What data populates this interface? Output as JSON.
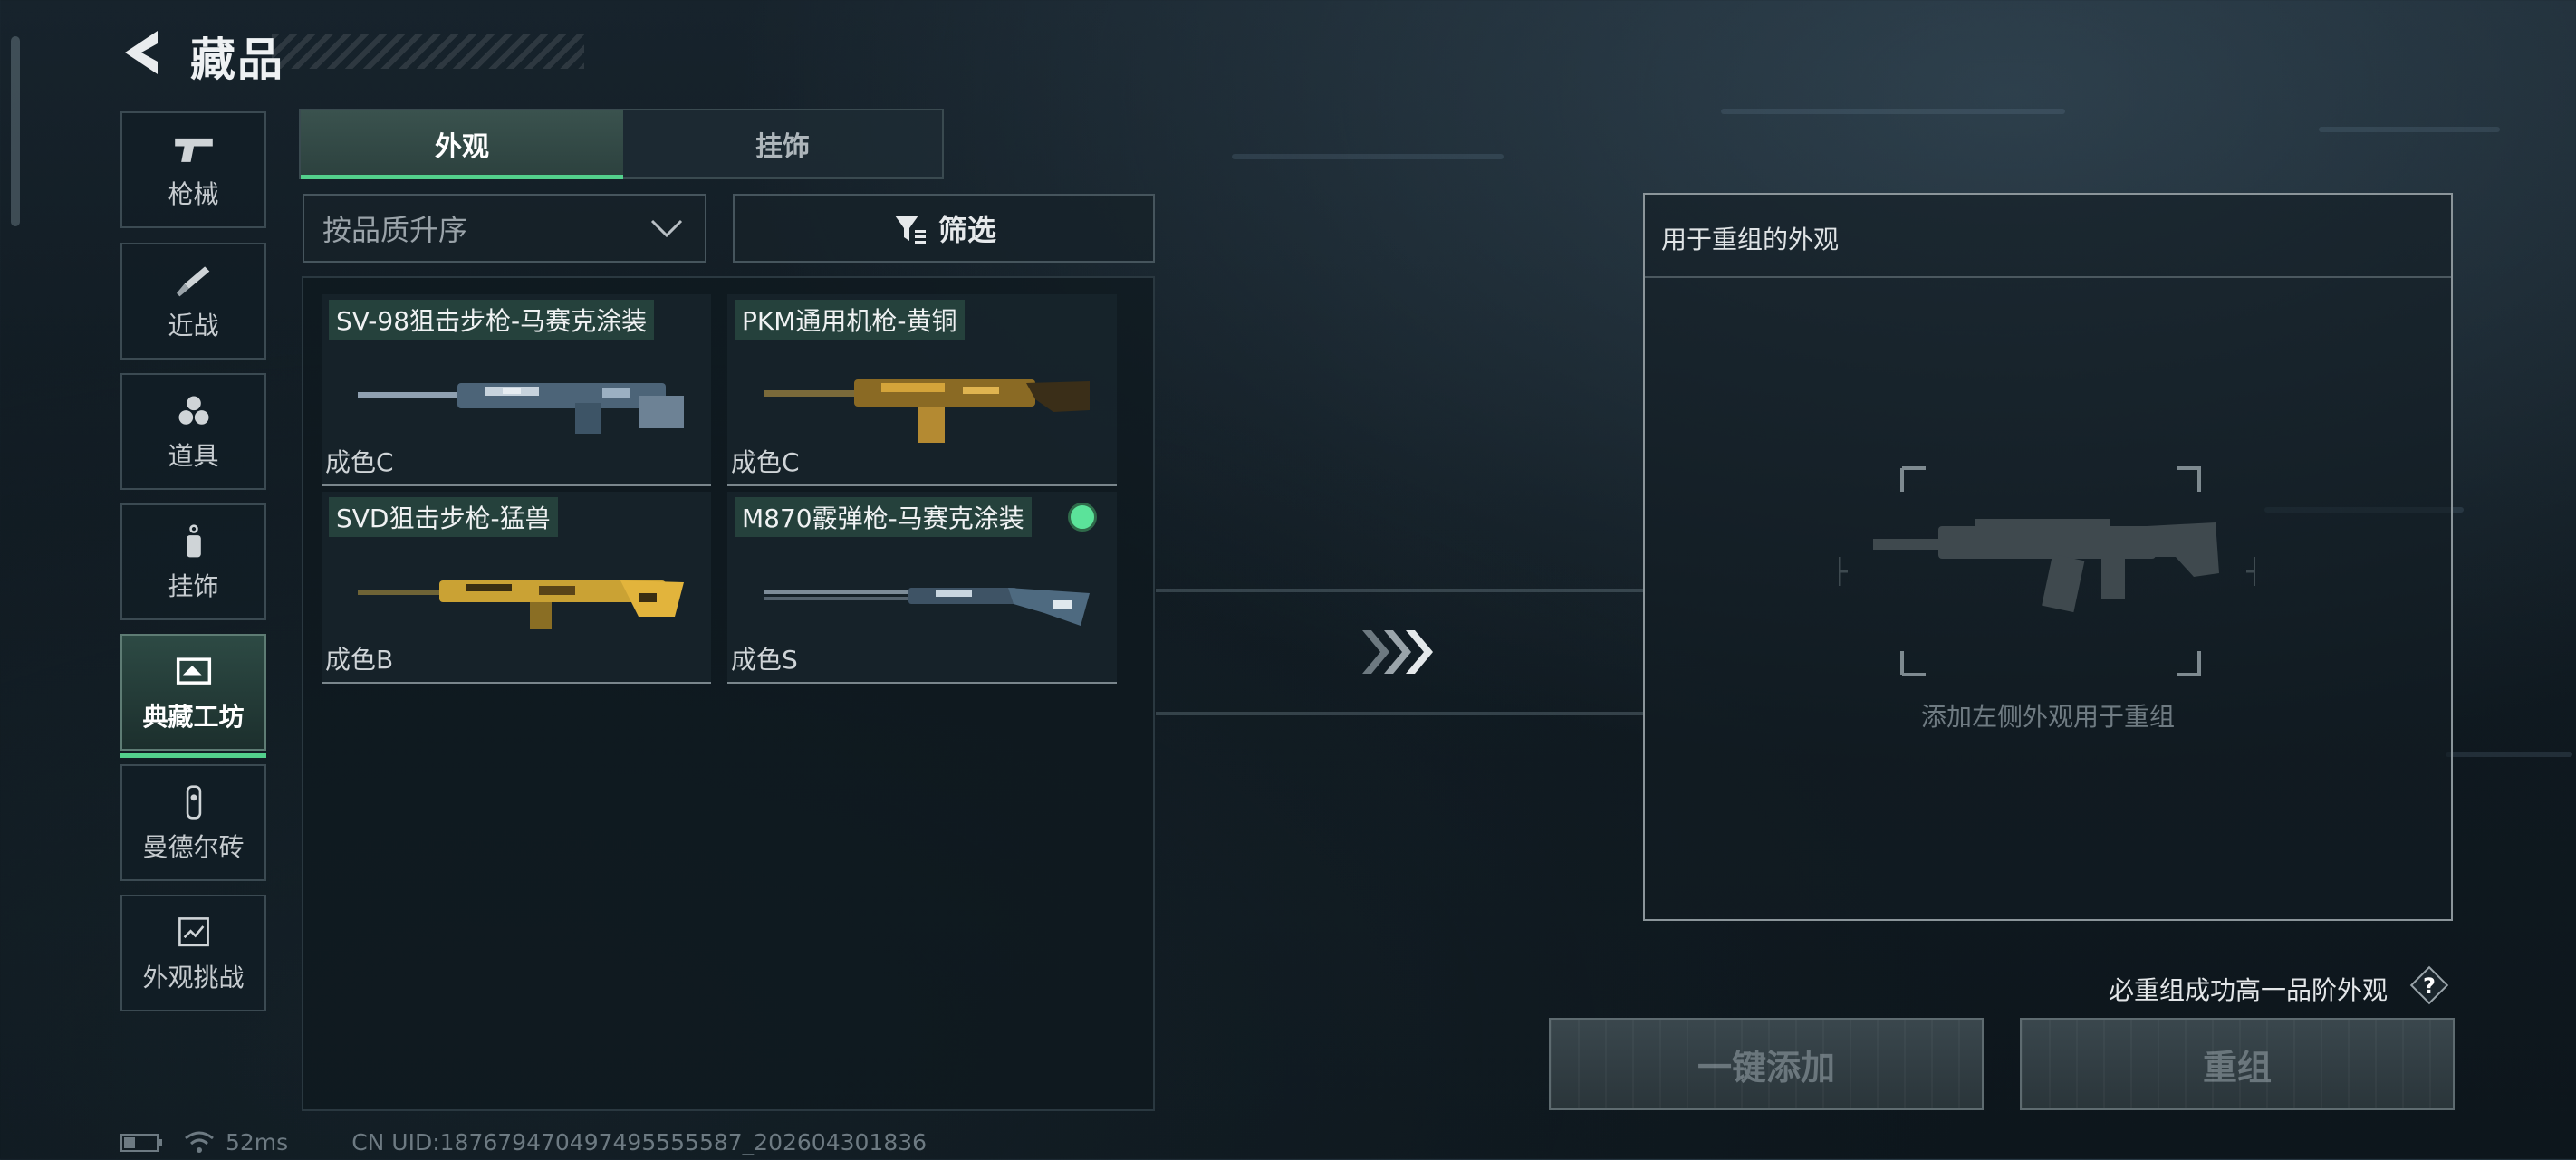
{
  "header": {
    "title": "藏品"
  },
  "sidebar": {
    "items": [
      {
        "label": "枪械",
        "icon": "pistol-icon",
        "active": false
      },
      {
        "label": "近战",
        "icon": "knife-icon",
        "active": false
      },
      {
        "label": "道具",
        "icon": "hexagon-cluster-icon",
        "active": false
      },
      {
        "label": "挂饰",
        "icon": "charm-icon",
        "active": false
      },
      {
        "label": "典藏工坊",
        "icon": "workshop-icon",
        "active": true
      },
      {
        "label": "曼德尔砖",
        "icon": "brick-icon",
        "active": false
      },
      {
        "label": "外观挑战",
        "icon": "challenge-icon",
        "active": false
      }
    ]
  },
  "tabs": [
    {
      "label": "外观",
      "active": true
    },
    {
      "label": "挂饰",
      "active": false
    }
  ],
  "sort": {
    "value": "按品质升序"
  },
  "filter": {
    "label": "筛选"
  },
  "items": [
    {
      "name": "SV-98狙击步枪-马赛克涂装",
      "grade": "成色C",
      "selected": false
    },
    {
      "name": "PKM通用机枪-黄铜",
      "grade": "成色C",
      "selected": false
    },
    {
      "name": "SVD狙击步枪-猛兽",
      "grade": "成色B",
      "selected": false
    },
    {
      "name": "M870霰弹枪-马赛克涂装",
      "grade": "成色S",
      "selected": true
    }
  ],
  "remix_panel": {
    "header": "用于重组的外观",
    "hint": "添加左侧外观用于重组"
  },
  "guarantee": {
    "text": "必重组成功高一品阶外观",
    "help": "?"
  },
  "buttons": {
    "add_all": "一键添加",
    "remix": "重组"
  },
  "status": {
    "ping": "52ms",
    "uid": "CN UID:187679470497495555587_202604301836"
  },
  "colors": {
    "accent": "#53d08c",
    "background": "#121c23"
  }
}
